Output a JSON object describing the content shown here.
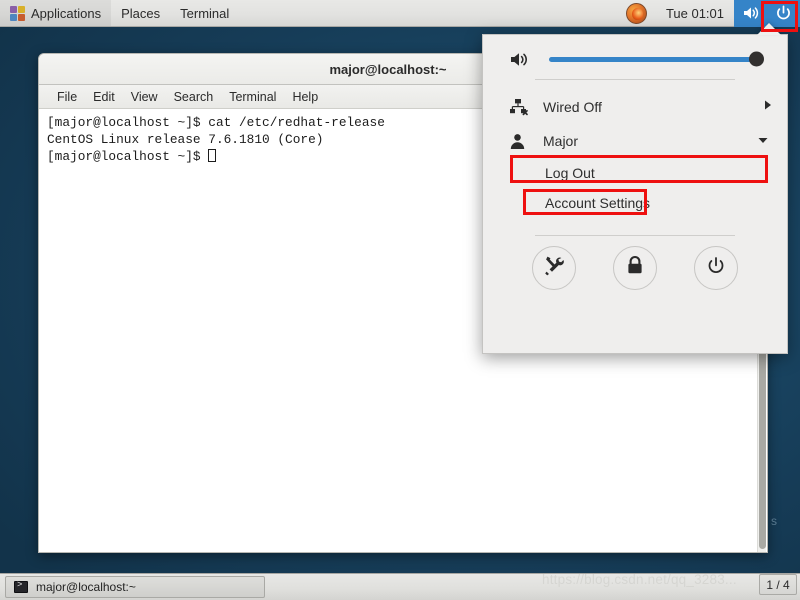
{
  "topbar": {
    "applications_label": "Applications",
    "places_label": "Places",
    "terminal_label": "Terminal",
    "clock": "Tue 01:01",
    "apps_icon": "applications-grid-icon",
    "firefox_icon": "firefox-icon",
    "volume_icon": "volume-high-icon",
    "power_icon": "power-icon",
    "tray_active_bg": "#3584c8"
  },
  "terminal": {
    "title": "major@localhost:~",
    "menus": [
      "File",
      "Edit",
      "View",
      "Search",
      "Terminal",
      "Help"
    ],
    "lines": [
      "[major@localhost ~]$ cat /etc/redhat-release",
      "CentOS Linux release 7.6.1810 (Core)",
      "[major@localhost ~]$ "
    ]
  },
  "system_menu": {
    "volume": {
      "icon": "volume-high-icon",
      "value": 100
    },
    "network": {
      "icon": "wired-disconnected-icon",
      "label": "Wired Off",
      "expand_icon": "chevron-right-icon"
    },
    "user": {
      "icon": "user-icon",
      "label": "Major",
      "expand_icon": "chevron-down-icon",
      "submenu": [
        {
          "label": "Log Out"
        },
        {
          "label": "Account Settings"
        }
      ]
    },
    "actions": [
      {
        "name": "settings-button",
        "icon": "tools-icon"
      },
      {
        "name": "lock-button",
        "icon": "lock-icon"
      },
      {
        "name": "power-button",
        "icon": "power-icon"
      }
    ]
  },
  "taskbar": {
    "window_button_label": "major@localhost:~",
    "window_icon": "terminal-icon",
    "workspace_indicator": "1 / 4",
    "watermark": "https://blog.csdn.net/qq_3283..."
  },
  "desktop": {
    "stray_char": "s"
  },
  "annotations": {
    "accent_color": "#ee1010",
    "boxes": [
      "power-tray-button",
      "user-row",
      "log-out-item"
    ]
  }
}
